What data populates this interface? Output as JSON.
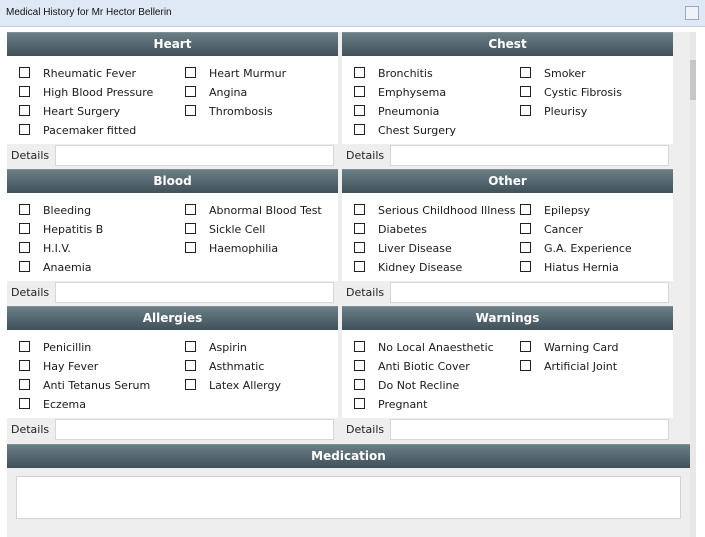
{
  "window": {
    "title": "Medical History for Mr Hector Bellerin"
  },
  "details_label": "Details",
  "panels": [
    {
      "title": "Heart",
      "items": [
        [
          "Rheumatic Fever",
          "High Blood Pressure",
          "Heart Surgery",
          "Pacemaker fitted"
        ],
        [
          "Heart Murmur",
          "Angina",
          "Thrombosis"
        ]
      ]
    },
    {
      "title": "Chest",
      "items": [
        [
          "Bronchitis",
          "Emphysema",
          "Pneumonia",
          "Chest Surgery"
        ],
        [
          "Smoker",
          "Cystic Fibrosis",
          "Pleurisy"
        ]
      ]
    },
    {
      "title": "Blood",
      "items": [
        [
          "Bleeding",
          "Hepatitis B",
          "H.I.V.",
          "Anaemia"
        ],
        [
          "Abnormal Blood Test",
          "Sickle Cell",
          "Haemophilia"
        ]
      ]
    },
    {
      "title": "Other",
      "items": [
        [
          "Serious Childhood Illness",
          "Diabetes",
          "Liver Disease",
          "Kidney Disease"
        ],
        [
          "Epilepsy",
          "Cancer",
          "G.A. Experience",
          "Hiatus Hernia"
        ]
      ]
    },
    {
      "title": "Allergies",
      "items": [
        [
          "Penicillin",
          "Hay Fever",
          "Anti Tetanus Serum",
          "Eczema"
        ],
        [
          "Aspirin",
          "Asthmatic",
          "Latex Allergy"
        ]
      ]
    },
    {
      "title": "Warnings",
      "items": [
        [
          "No Local Anaesthetic",
          "Anti Biotic Cover",
          "Do Not Recline",
          "Pregnant"
        ],
        [
          "Warning Card",
          "Artificial Joint"
        ]
      ]
    }
  ],
  "medication": {
    "title": "Medication"
  }
}
